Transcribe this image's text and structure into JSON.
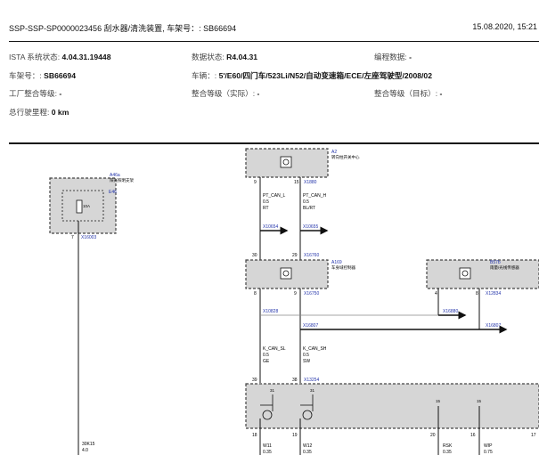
{
  "header": {
    "title": "SSP-SSP-SP0000023456 刮水器/清洗装置, 车架号：: SB66694",
    "date": "15.08.2020, 15:21"
  },
  "info": {
    "ista_label": "ISTA 系统状态:",
    "ista_value": "4.04.31.19448",
    "data_label": "数据状态:",
    "data_value": "R4.04.31",
    "coding_label": "编程数据:",
    "coding_value": "-",
    "vin_label": "车架号：:",
    "vin_value": "SB66694",
    "vehicle_label": "车辆：:",
    "vehicle_value": "5'/E60/四门车/523Li/N52/自动变速箱/ECE/左座驾驶型/2008/02",
    "factory_label": "工厂整合等级:",
    "factory_value": "-",
    "actual_label": "整合等级（实际）:",
    "actual_value": "-",
    "target_label": "整合等级（目标）:",
    "target_value": "-",
    "mileage_label": "总行驶里程:",
    "mileage_value": "0 km"
  },
  "diagram": {
    "a46": {
      "ref": "A46a",
      "name": "阳光照明支架",
      "conn": "E46",
      "fuse": "10A",
      "pin": "7",
      "plug": "X16003"
    },
    "a2": {
      "ref": "A2",
      "name": "转向柱开关中心"
    },
    "a2_pins": [
      "9",
      "15"
    ],
    "a2_plug": "X1880",
    "wire_can_l": {
      "name": "PT_CAN_L",
      "size": "0.5",
      "color": "RT"
    },
    "wire_can_h": {
      "name": "PT_CAN_H",
      "size": "0.5",
      "color": "BL/RT"
    },
    "conn1": "X10654",
    "conn2": "X10655",
    "pins_mid": [
      "30",
      "29"
    ],
    "plug_mid": "X16760",
    "a169": {
      "ref": "A169",
      "name": "车身域控制器"
    },
    "a169_pins": [
      "8",
      "9"
    ],
    "a169_plug": "X16750",
    "b57b": {
      "ref": "B57b",
      "name": "雨量/光线传感器",
      "pin": "4",
      "pin2": "8",
      "plug": "X12834"
    },
    "bus_left": "X10828",
    "bus_left2": "X16807",
    "bus_right": "X16880",
    "bus_right2": "X16807",
    "wire_k_can_sl": {
      "name": "K_CAN_SL",
      "size": "0.5",
      "color": "GE"
    },
    "wire_k_can_sh": {
      "name": "K_CAN_SH",
      "size": "0.5",
      "color": "SW"
    },
    "pins_low": [
      "39",
      "38"
    ],
    "plug_low": "X13254",
    "bottom_pins": [
      "18",
      "19",
      "20",
      "16",
      "17"
    ],
    "sub_pins": [
      "31",
      "31",
      "15",
      "15"
    ],
    "wire_w11": {
      "name": "W11",
      "size": "0.35"
    },
    "wire_w12": {
      "name": "W12",
      "size": "0.35"
    },
    "wire_rsk": {
      "name": "RSK",
      "size": "0.35"
    },
    "wire_wip": {
      "name": "WIP",
      "size": "0.75"
    },
    "wire_left": {
      "name": "30K15",
      "size": "4.0"
    }
  }
}
